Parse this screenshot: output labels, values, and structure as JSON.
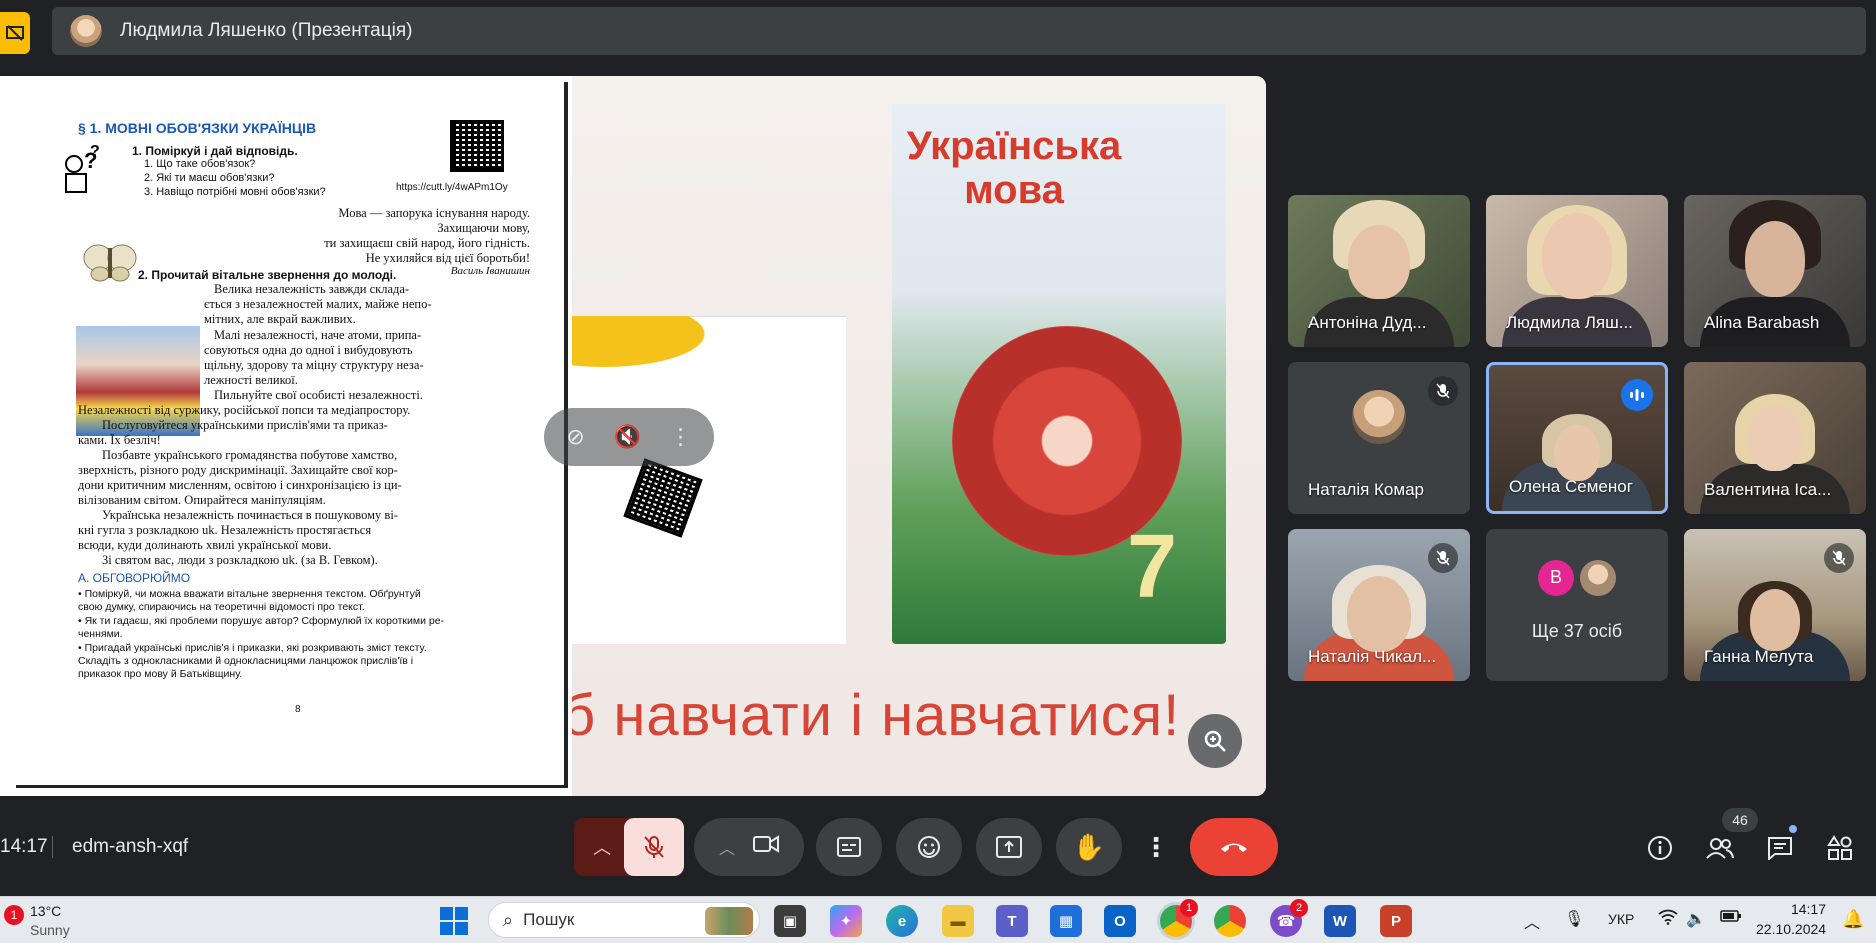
{
  "presenter": {
    "name": "Людмила Ляшенко (Презентація)"
  },
  "textbook": {
    "section_title": "§ 1. МОВНІ ОБОВ'ЯЗКИ УКРАЇНЦІВ",
    "task1_title": "1. Поміркуй і дай відповідь.",
    "task1_q1": "1. Що таке обов'язок?",
    "task1_q2": "2. Які  ти маєш обов'язки?",
    "task1_q3": "3. Навіщо потрібні мовні обов'язки?",
    "link": "https://cutt.ly/4wAPm1Oy",
    "poem": [
      "Мова — запорука існування народу.",
      "Захищаючи мову,",
      "ти захищаєш свій народ, його гідність.",
      "Не ухиляйся від цієї боротьби!"
    ],
    "poem_author": "Василь Іванишин",
    "task2_title": "2. Прочитай вітальне звернення до молоді.",
    "body_lines": [
      "Велика незалежність завжди склада-",
      "ється з незалежностей малих, майже непо-",
      "мітних, але вкрай важливих.",
      "Малі незалежності, наче атоми, припа-",
      "совуються одна до одної і вибудовують",
      "щільну, здорову та міцну структуру неза-",
      "лежності великої.",
      "Пильнуйте свої особисті незалежності.",
      "Незалежності від суржику, російської попси та медіапростору.",
      "Послуговуйтеся українськими прислів'ями та приказ-",
      "ками. Їх безліч!",
      "Позбавте українського громадянства побутове хамство,",
      "зверхність, різного роду дискримінації. Захищайте свої кор-",
      "дони критичним мисленням, освітою і синхронізацією із ци-",
      "вілізованим світом. Опирайтеся маніпуляціям.",
      "Українська незалежність починається в пошуковому ві-",
      "кні гугла з розкладкою uk. Незалежність простягається",
      "всюди, куди долинають хвилі української мови.",
      "Зі святом вас, люди з розкладкою uk. (за В. Гевком)."
    ],
    "heading_a": "А. ОБГОВОРЮЙМО",
    "bullets": [
      "• Поміркуй, чи можна вважати вітальне звернення текстом. Обґрунтуй",
      "   свою думку, спираючись на теоретичні відомості про текст.",
      "• Як ти гадаєш, які проблеми порушує автор? Сформулюй їх короткими ре-",
      "   ченнями.",
      "• Пригадай українські прислів'я і приказки, які розкривають зміст тексту.",
      "   Складіть з однокласниками й однокласницями ланцюжок прислів'їв і",
      "   приказок про мову й Батьківщину."
    ],
    "page_number": "8"
  },
  "slide": {
    "title_line1": "Українська",
    "title_line2": "мова",
    "grade": "7",
    "bottom_text": "б навчати і навчатися!"
  },
  "participants": [
    {
      "name": "Антоніна Дуд...",
      "muted": false,
      "speaking": false
    },
    {
      "name": "Людмила Ляш...",
      "muted": false,
      "speaking": false
    },
    {
      "name": "Alina Barabash",
      "muted": false,
      "speaking": false
    },
    {
      "name": "Наталія Комар",
      "muted": true,
      "speaking": false
    },
    {
      "name": "Олена Семеног",
      "muted": false,
      "speaking": true
    },
    {
      "name": "Валентина Іса...",
      "muted": false,
      "speaking": false
    },
    {
      "name": "Наталія Чикал...",
      "muted": true,
      "speaking": false
    },
    {
      "name": "Ганна Мелута",
      "muted": true,
      "speaking": false
    }
  ],
  "more_tile": {
    "avatar_letter": "В",
    "label": "Ще 37 осіб"
  },
  "call_bar": {
    "time": "14:17",
    "meeting_code": "edm-ansh-xqf",
    "people_count": "46"
  },
  "taskbar": {
    "weather_badge": "1",
    "temperature": "13°C",
    "condition": "Sunny",
    "search_placeholder": "Пошук",
    "viber_badge": "2",
    "chrome_badge": "1",
    "language": "УКР",
    "clock_time": "14:17",
    "clock_date": "22.10.2024"
  },
  "colors": {
    "accent_blue": "#1a73e8",
    "leave_red": "#ea4335",
    "mic_off_bg": "#f9dedc",
    "present_yellow": "#fbbc04"
  }
}
